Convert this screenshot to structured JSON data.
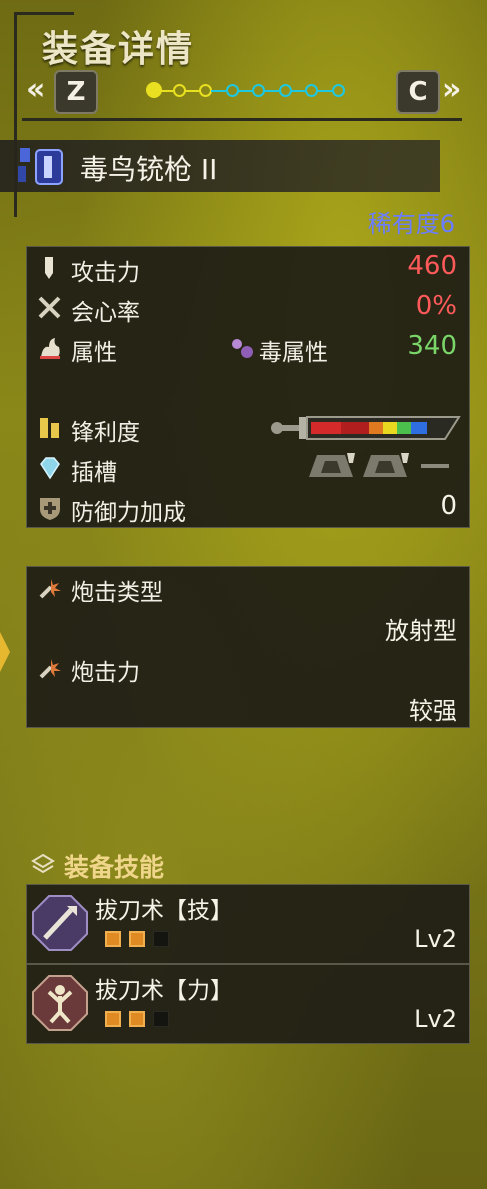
{
  "header": {
    "title": "装备详情",
    "left_key": "Z",
    "right_key": "C",
    "left_arrow": "«",
    "right_arrow": "»",
    "page_dots": {
      "total": 8,
      "active_index": 0,
      "yellow_count": 3
    }
  },
  "weapon": {
    "name": "毒鸟铳枪 II",
    "rarity": "稀有度6"
  },
  "stats": {
    "attack": {
      "label": "攻击力",
      "value": "460"
    },
    "affinity": {
      "label": "会心率",
      "value": "0%"
    },
    "element": {
      "label": "属性",
      "type": "毒属性",
      "value": "340"
    },
    "sharpness": {
      "label": "锋利度"
    },
    "slots": {
      "label": "插槽"
    },
    "defense_bonus": {
      "label": "防御力加成",
      "value": "0"
    }
  },
  "shelling": {
    "type_label": "炮击类型",
    "type_value": "放射型",
    "power_label": "炮击力",
    "power_value": "较强"
  },
  "skills": {
    "heading": "装备技能",
    "items": [
      {
        "name": "拔刀术【技】",
        "level": "Lv2",
        "points": 2,
        "max": 3
      },
      {
        "name": "拔刀术【力】",
        "level": "Lv2",
        "points": 2,
        "max": 3
      }
    ]
  },
  "colors": {
    "attack_value": "#ff5a5a",
    "affinity_value": "#ff5a5a",
    "element_value": "#7bd66a",
    "rarity": "#6a7dff",
    "dot_yellow": "#e8e020",
    "dot_cyan": "#1ec8e0"
  },
  "icons": {
    "weapon": "gunlance-icon",
    "attack": "blade-icon",
    "affinity": "crossed-swords-icon",
    "element": "element-flame-icon",
    "poison": "poison-bubbles-icon",
    "sharpness": "sharpness-icon",
    "slots": "gem-icon",
    "defense": "shield-plus-icon",
    "shelling": "shelling-burst-icon",
    "skills": "skill-layers-icon",
    "skill_1": "sword-crest-icon",
    "skill_2": "power-crest-icon"
  }
}
